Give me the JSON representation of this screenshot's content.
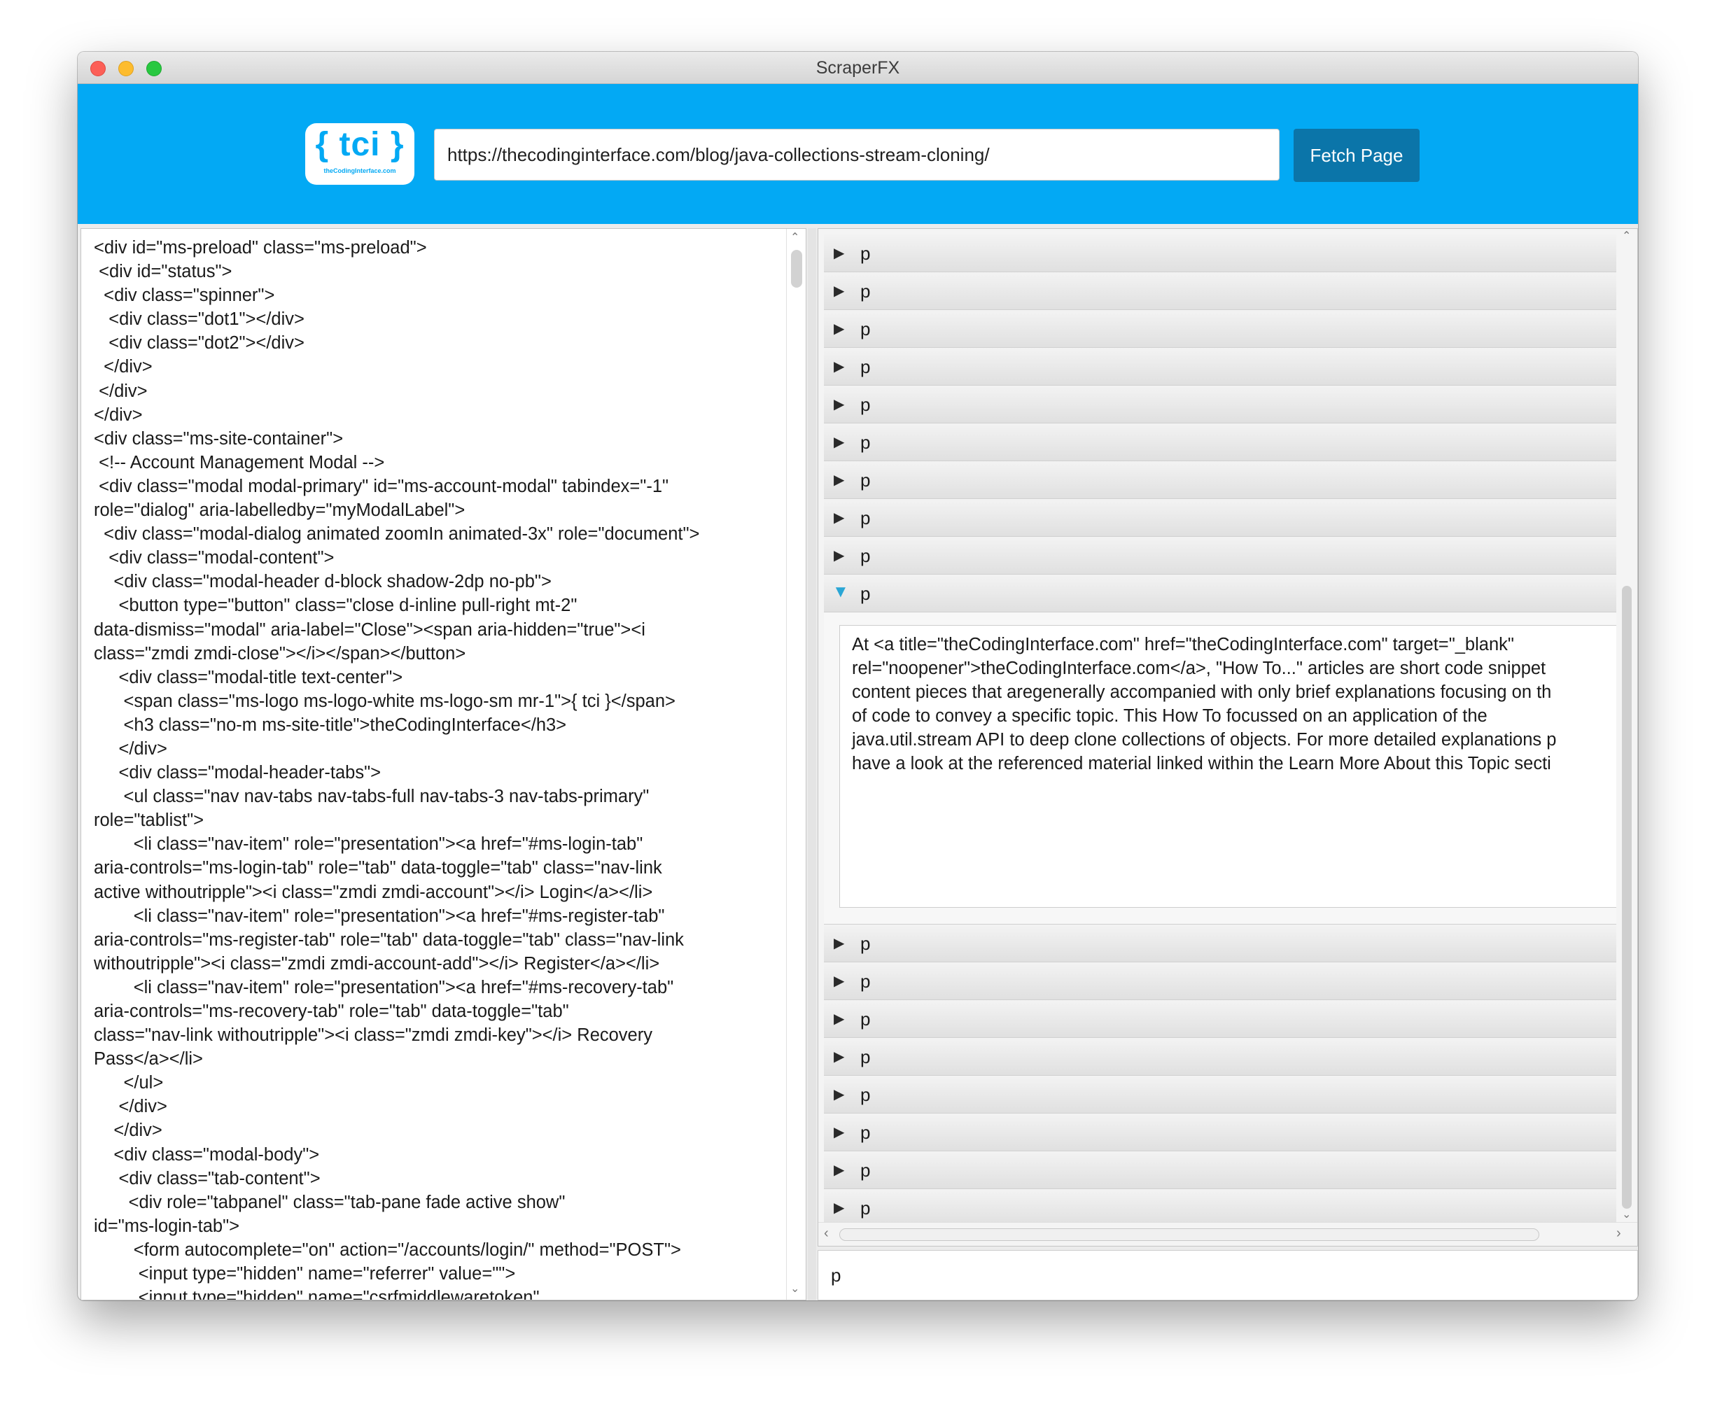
{
  "window": {
    "title": "ScraperFX"
  },
  "header": {
    "logo": {
      "main": "{ tci }",
      "sub": "theCodingInterface.com"
    },
    "url_value": "https://thecodinginterface.com/blog/java-collections-stream-cloning/",
    "fetch_label": "Fetch Page"
  },
  "source_html": "<div id=\"ms-preload\" class=\"ms-preload\">\n <div id=\"status\">\n  <div class=\"spinner\">\n   <div class=\"dot1\"></div>\n   <div class=\"dot2\"></div>\n  </div>\n </div>\n</div>\n<div class=\"ms-site-container\">\n <!-- Account Management Modal -->\n <div class=\"modal modal-primary\" id=\"ms-account-modal\" tabindex=\"-1\"\nrole=\"dialog\" aria-labelledby=\"myModalLabel\">\n  <div class=\"modal-dialog animated zoomIn animated-3x\" role=\"document\">\n   <div class=\"modal-content\">\n    <div class=\"modal-header d-block shadow-2dp no-pb\">\n     <button type=\"button\" class=\"close d-inline pull-right mt-2\"\ndata-dismiss=\"modal\" aria-label=\"Close\"><span aria-hidden=\"true\"><i\nclass=\"zmdi zmdi-close\"></i></span></button>\n     <div class=\"modal-title text-center\">\n      <span class=\"ms-logo ms-logo-white ms-logo-sm mr-1\">{ tci }</span>\n      <h3 class=\"no-m ms-site-title\">theCodingInterface</h3>\n     </div>\n     <div class=\"modal-header-tabs\">\n      <ul class=\"nav nav-tabs nav-tabs-full nav-tabs-3 nav-tabs-primary\"\nrole=\"tablist\">\n        <li class=\"nav-item\" role=\"presentation\"><a href=\"#ms-login-tab\"\naria-controls=\"ms-login-tab\" role=\"tab\" data-toggle=\"tab\" class=\"nav-link\nactive withoutripple\"><i class=\"zmdi zmdi-account\"></i> Login</a></li>\n        <li class=\"nav-item\" role=\"presentation\"><a href=\"#ms-register-tab\"\naria-controls=\"ms-register-tab\" role=\"tab\" data-toggle=\"tab\" class=\"nav-link\nwithoutripple\"><i class=\"zmdi zmdi-account-add\"></i> Register</a></li>\n        <li class=\"nav-item\" role=\"presentation\"><a href=\"#ms-recovery-tab\"\naria-controls=\"ms-recovery-tab\" role=\"tab\" data-toggle=\"tab\"\nclass=\"nav-link withoutripple\"><i class=\"zmdi zmdi-key\"></i> Recovery\nPass</a></li>\n      </ul>\n     </div>\n    </div>\n    <div class=\"modal-body\">\n     <div class=\"tab-content\">\n       <div role=\"tabpanel\" class=\"tab-pane fade active show\"\nid=\"ms-login-tab\">\n        <form autocomplete=\"on\" action=\"/accounts/login/\" method=\"POST\">\n         <input type=\"hidden\" name=\"referrer\" value=\"\">\n         <input type=\"hidden\" name=\"csrfmiddlewaretoken\"",
  "tree": {
    "rows_before": [
      "p",
      "p",
      "p",
      "p",
      "p",
      "p",
      "p",
      "p",
      "p"
    ],
    "expanded_label": "p",
    "expanded_text": "At <a title=\"theCodingInterface.com\" href=\"theCodingInterface.com\" target=\"_blank\"\nrel=\"noopener\">theCodingInterface.com</a>, \"How To...\" articles are short code snippet\ncontent pieces that aregenerally accompanied with only brief explanations focusing on th\nof code to convey a specific topic. This How To focussed on an application of the\njava.util.stream API to deep clone collections of objects. For more detailed explanations p\nhave a look at the referenced material linked within the Learn More About this Topic secti",
    "rows_after": [
      "p",
      "p",
      "p",
      "p",
      "p",
      "p",
      "p",
      "p"
    ]
  },
  "status_text": "p"
}
